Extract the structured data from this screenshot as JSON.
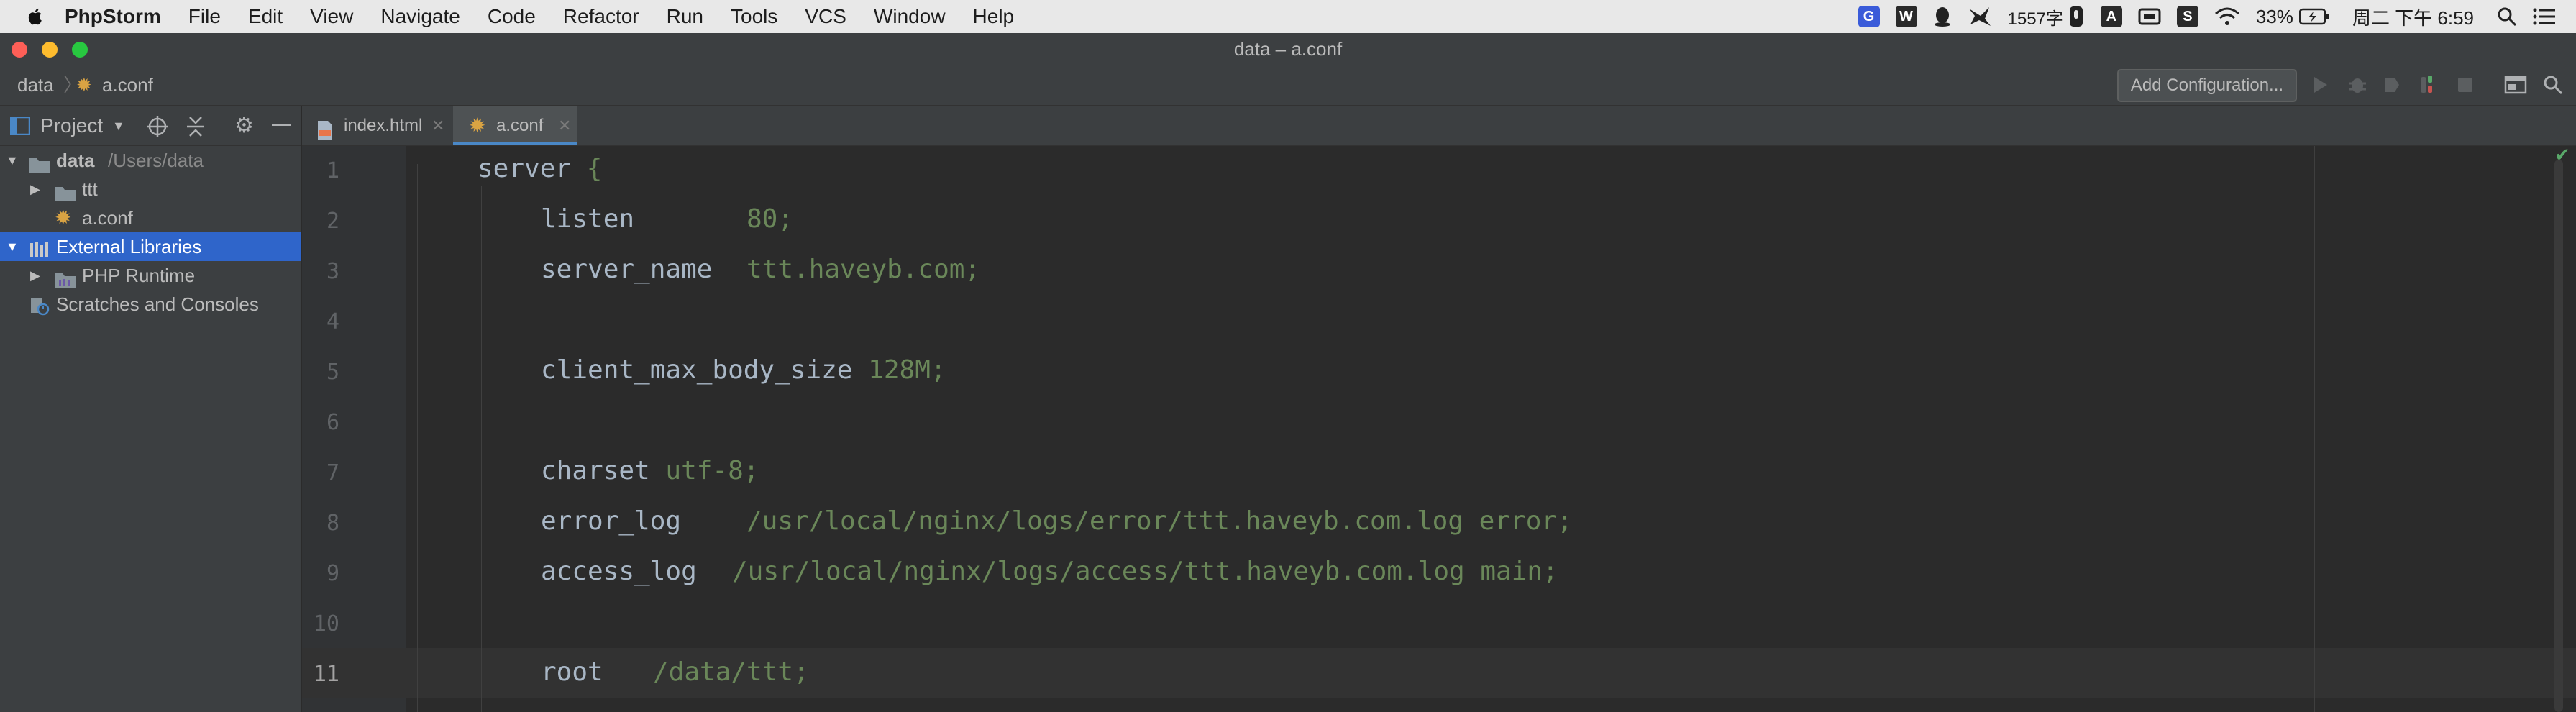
{
  "menubar": {
    "app_name": "PhpStorm",
    "items": [
      "File",
      "Edit",
      "View",
      "Navigate",
      "Code",
      "Refactor",
      "Run",
      "Tools",
      "VCS",
      "Window",
      "Help"
    ],
    "status_count": "1557字",
    "ime_label": "A",
    "battery": "33%",
    "clock": "周二 下午 6:59"
  },
  "window": {
    "title": "data – a.conf"
  },
  "navbar": {
    "crumb_root": "data",
    "crumb_file": "a.conf",
    "add_configuration": "Add Configuration..."
  },
  "project_panel": {
    "title": "Project",
    "tree": [
      {
        "label": "data",
        "extra": "/Users/data",
        "icon": "folder-icon"
      },
      {
        "label": "ttt",
        "icon": "folder-icon"
      },
      {
        "label": "a.conf",
        "icon": "config-file-icon"
      },
      {
        "label": "External Libraries",
        "icon": "library-icon"
      },
      {
        "label": "PHP Runtime",
        "icon": "library-folder-icon"
      },
      {
        "label": "Scratches and Consoles",
        "icon": "scratch-icon"
      }
    ]
  },
  "tabs": [
    {
      "label": "index.html",
      "icon": "html-file-icon"
    },
    {
      "label": "a.conf",
      "icon": "config-file-icon",
      "active": true
    }
  ],
  "editor": {
    "current_line": 11,
    "line_numbers": [
      "1",
      "2",
      "3",
      "4",
      "5",
      "6",
      "7",
      "8",
      "9",
      "10",
      "11"
    ],
    "lines": [
      {
        "key": "server",
        "value": "{"
      },
      {
        "key": "listen",
        "value": "80;"
      },
      {
        "key": "server_name",
        "value": "ttt.haveyb.com;"
      },
      {
        "key": "",
        "value": ""
      },
      {
        "key": "client_max_body_size",
        "value": "128M;"
      },
      {
        "key": "",
        "value": ""
      },
      {
        "key": "charset",
        "value": "utf-8;"
      },
      {
        "key": "error_log",
        "value": "/usr/local/nginx/logs/error/ttt.haveyb.com.log error;"
      },
      {
        "key": "access_log",
        "value": "/usr/local/nginx/logs/access/ttt.haveyb.com.log main;"
      },
      {
        "key": "",
        "value": ""
      },
      {
        "key": "root",
        "value": "/data/ttt;"
      }
    ]
  },
  "colors": {
    "selection": "#2f65ca",
    "string_value": "#6a8759",
    "keyword": "#a9b7c6",
    "accent_tab": "#4a88c7"
  }
}
